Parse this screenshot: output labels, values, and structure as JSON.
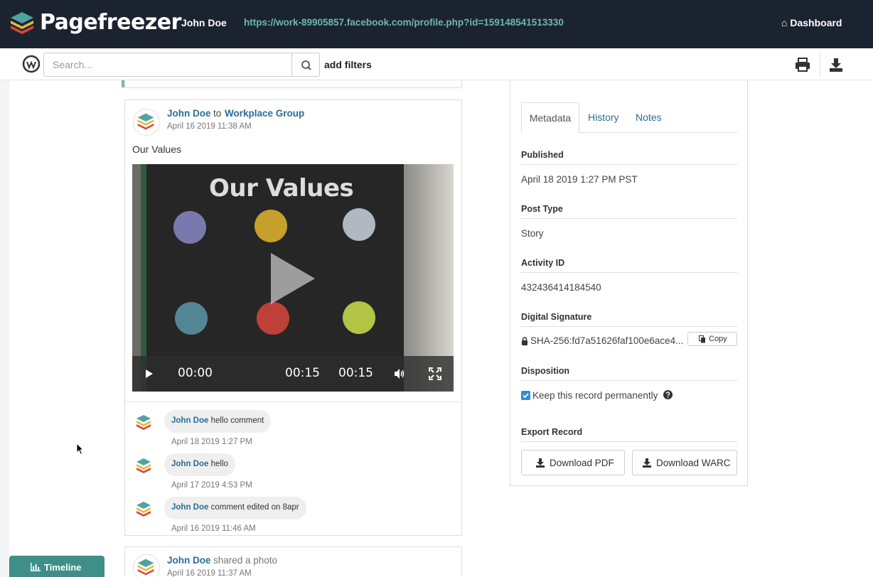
{
  "header": {
    "brand": "Pagefreezer",
    "user_name": "John Doe",
    "profile_url": "https://work-89905857.facebook.com/profile.php?id=159148541513330",
    "dashboard_label": "Dashboard"
  },
  "toolbar": {
    "search_placeholder": "Search...",
    "add_filters_label": "add filters"
  },
  "post": {
    "author": "John Doe",
    "to_text": "to",
    "group": "Workplace Group",
    "date": "April 16 2019 11:38 AM",
    "text": "Our Values",
    "video": {
      "title_in_frame": "Our Values",
      "current_time": "00:00",
      "position_time": "00:15",
      "duration": "00:15"
    },
    "comments": [
      {
        "author": "John Doe",
        "text": "hello comment",
        "date": "April 18 2019 1:27 PM"
      },
      {
        "author": "John Doe",
        "text": "hello",
        "date": "April 17 2019 4:53 PM"
      },
      {
        "author": "John Doe",
        "text": "comment edited on 8apr",
        "date": "April 16 2019 11:46 AM"
      }
    ]
  },
  "next_post": {
    "author": "John Doe",
    "action": "shared a photo",
    "date": "April 16 2019 11:37 AM"
  },
  "metadata": {
    "tabs": [
      "Metadata",
      "History",
      "Notes"
    ],
    "active_tab": "Metadata",
    "published_label": "Published",
    "published_value": "April 18 2019 1:27 PM PST",
    "post_type_label": "Post Type",
    "post_type_value": "Story",
    "activity_id_label": "Activity ID",
    "activity_id_value": "432436414184540",
    "signature_label": "Digital Signature",
    "signature_value": "SHA-256:fd7a51626faf100e6ace4...",
    "copy_label": "Copy",
    "disposition_label": "Disposition",
    "keep_label": "Keep this record permanently",
    "keep_checked": true,
    "export_label": "Export Record",
    "download_pdf_label": "Download PDF",
    "download_warc_label": "Download WARC"
  },
  "footer": {
    "timeline_label": "Timeline"
  },
  "colors": {
    "topbar": "#1c2330",
    "link": "#2a6d97",
    "url": "#6db8b0",
    "timeline": "#3f8f89",
    "checkbox": "#2f8fd4"
  }
}
